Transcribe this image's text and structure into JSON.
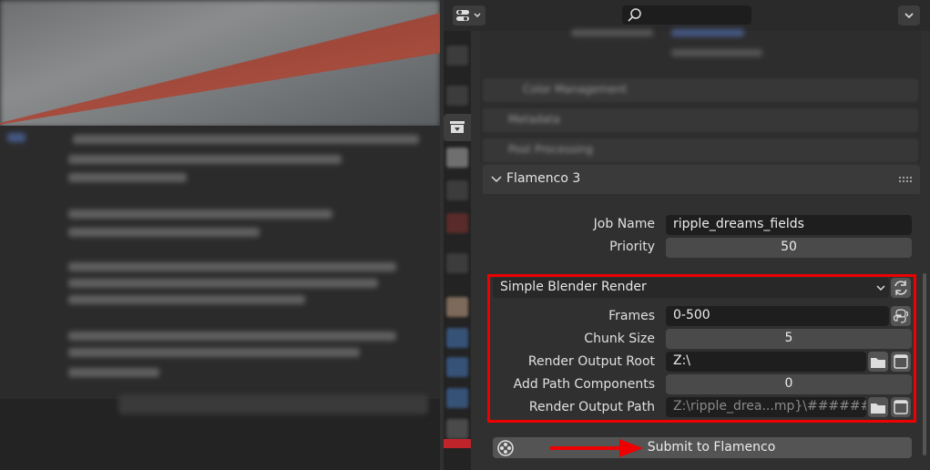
{
  "top_bar": {
    "editor_type_icon": "properties-editor-icon",
    "search_placeholder": ""
  },
  "panel": {
    "collapsed_sections": [
      "Color Management",
      "Metadata",
      "Post Processing"
    ],
    "flamenco": {
      "title": "Flamenco 3",
      "job_name_label": "Job Name",
      "job_name_value": "ripple_dreams_fields",
      "priority_label": "Priority",
      "priority_value": "50",
      "job_type": "Simple Blender Render",
      "frames_label": "Frames",
      "frames_value": "0-500",
      "chunk_size_label": "Chunk Size",
      "chunk_size_value": "5",
      "render_output_root_label": "Render Output Root",
      "render_output_root_value": "Z:\\",
      "add_path_components_label": "Add Path Components",
      "add_path_components_value": "0",
      "render_output_path_label": "Render Output Path",
      "render_output_path_value": "Z:\\ripple_drea...mp}\\######",
      "submit_label": "Submit to Flamenco"
    }
  },
  "colors": {
    "highlight": "#e00000",
    "panel_bg": "#303030",
    "field_bg": "#1e1e1e"
  }
}
